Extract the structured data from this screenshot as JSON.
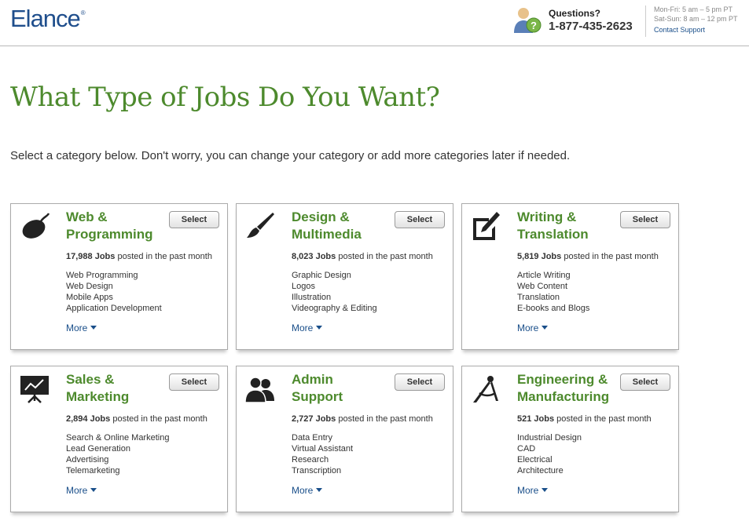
{
  "header": {
    "logo": "Elance",
    "logo_mark": "®",
    "questions_label": "Questions?",
    "phone": "1-877-435-2623",
    "hours_weekday": "Mon-Fri: 5 am – 5 pm PT",
    "hours_weekend": "Sat-Sun: 8 am – 12 pm PT",
    "contact_link": "Contact Support"
  },
  "page": {
    "title": "What Type of Jobs Do You Want?",
    "intro": "Select a category below. Don't worry, you can change your category or add more categories later if needed."
  },
  "buttons": {
    "select": "Select",
    "more": "More"
  },
  "jobs_suffix": "Jobs",
  "jobs_tail": "posted in the past month",
  "categories": [
    {
      "icon": "mouse-icon",
      "title_line1": "Web &",
      "title_line2": "Programming",
      "jobs": "17,988",
      "skills": [
        "Web Programming",
        "Web Design",
        "Mobile Apps",
        "Application Development"
      ]
    },
    {
      "icon": "brush-icon",
      "title_line1": "Design &",
      "title_line2": "Multimedia",
      "jobs": "8,023",
      "skills": [
        "Graphic Design",
        "Logos",
        "Illustration",
        "Videography & Editing"
      ]
    },
    {
      "icon": "pen-paper-icon",
      "title_line1": "Writing &",
      "title_line2": "Translation",
      "jobs": "5,819",
      "skills": [
        "Article Writing",
        "Web Content",
        "Translation",
        "E-books and Blogs"
      ]
    },
    {
      "icon": "presentation-icon",
      "title_line1": "Sales &",
      "title_line2": "Marketing",
      "jobs": "2,894",
      "skills": [
        "Search & Online Marketing",
        "Lead Generation",
        "Advertising",
        "Telemarketing"
      ]
    },
    {
      "icon": "people-icon",
      "title_line1": "Admin",
      "title_line2": "Support",
      "jobs": "2,727",
      "skills": [
        "Data Entry",
        "Virtual Assistant",
        "Research",
        "Transcription"
      ]
    },
    {
      "icon": "compass-icon",
      "title_line1": "Engineering &",
      "title_line2": "Manufacturing",
      "jobs": "521",
      "skills": [
        "Industrial Design",
        "CAD",
        "Electrical",
        "Architecture"
      ]
    }
  ]
}
